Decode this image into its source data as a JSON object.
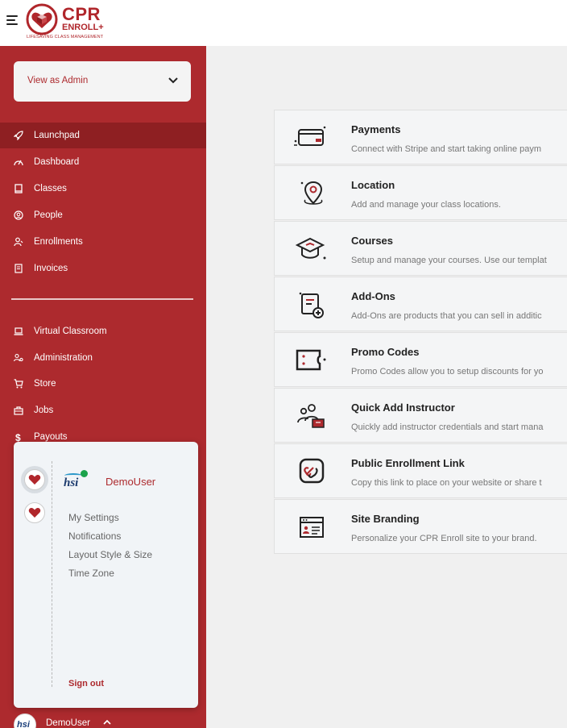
{
  "brand": {
    "name": "CPR",
    "sub": "ENROLL+",
    "tagline": "LIFESAVING CLASS MANAGEMENT",
    "color": "#ad2a2e"
  },
  "sidebar": {
    "view_select": "View as Admin",
    "items": [
      {
        "label": "Launchpad",
        "icon": "rocket-icon",
        "active": true
      },
      {
        "label": "Dashboard",
        "icon": "gauge-icon"
      },
      {
        "label": "Classes",
        "icon": "book-icon"
      },
      {
        "label": "People",
        "icon": "person-circle-icon"
      },
      {
        "label": "Enrollments",
        "icon": "user-add-icon"
      },
      {
        "label": "Invoices",
        "icon": "receipt-icon"
      },
      {
        "label": "Virtual Classroom",
        "icon": "laptop-icon"
      },
      {
        "label": "Administration",
        "icon": "admin-users-icon"
      },
      {
        "label": "Store",
        "icon": "cart-icon"
      },
      {
        "label": "Jobs",
        "icon": "briefcase-icon"
      },
      {
        "label": "Payouts",
        "icon": "dollar-icon"
      }
    ],
    "bottom_user": "DemoUser",
    "bottom_org": "hsi"
  },
  "popover": {
    "org_text": "hsi",
    "user_name": "DemoUser",
    "links": [
      "My Settings",
      "Notifications",
      "Layout Style & Size",
      "Time Zone"
    ],
    "sign_out": "Sign out"
  },
  "launchpad": {
    "cards": [
      {
        "title": "Payments",
        "desc": "Connect with Stripe and start taking online paym",
        "icon": "credit-card-icon"
      },
      {
        "title": "Location",
        "desc": "Add and manage your class locations.",
        "icon": "location-pin-icon"
      },
      {
        "title": "Courses",
        "desc": "Setup and manage your courses. Use our templat",
        "icon": "graduation-cap-icon"
      },
      {
        "title": "Add-Ons",
        "desc": "Add-Ons are products that you can sell in additic",
        "icon": "list-add-icon"
      },
      {
        "title": "Promo Codes",
        "desc": "Promo Codes allow you to setup discounts for yo",
        "icon": "ticket-icon"
      },
      {
        "title": "Quick Add Instructor",
        "desc": "Quickly add instructor credentials and start mana",
        "icon": "instructor-icon"
      },
      {
        "title": "Public Enrollment Link",
        "desc": "Copy this link to place on your website or share t",
        "icon": "link-icon"
      },
      {
        "title": "Site Branding",
        "desc": "Personalize your CPR Enroll site to your brand.",
        "icon": "browser-id-icon"
      }
    ]
  }
}
